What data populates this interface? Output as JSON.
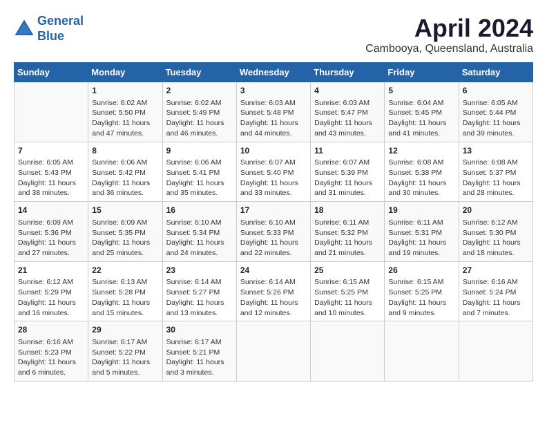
{
  "logo": {
    "line1": "General",
    "line2": "Blue"
  },
  "title": "April 2024",
  "subtitle": "Cambooya, Queensland, Australia",
  "headers": [
    "Sunday",
    "Monday",
    "Tuesday",
    "Wednesday",
    "Thursday",
    "Friday",
    "Saturday"
  ],
  "weeks": [
    [
      {
        "day": "",
        "info": ""
      },
      {
        "day": "1",
        "info": "Sunrise: 6:02 AM\nSunset: 5:50 PM\nDaylight: 11 hours\nand 47 minutes."
      },
      {
        "day": "2",
        "info": "Sunrise: 6:02 AM\nSunset: 5:49 PM\nDaylight: 11 hours\nand 46 minutes."
      },
      {
        "day": "3",
        "info": "Sunrise: 6:03 AM\nSunset: 5:48 PM\nDaylight: 11 hours\nand 44 minutes."
      },
      {
        "day": "4",
        "info": "Sunrise: 6:03 AM\nSunset: 5:47 PM\nDaylight: 11 hours\nand 43 minutes."
      },
      {
        "day": "5",
        "info": "Sunrise: 6:04 AM\nSunset: 5:45 PM\nDaylight: 11 hours\nand 41 minutes."
      },
      {
        "day": "6",
        "info": "Sunrise: 6:05 AM\nSunset: 5:44 PM\nDaylight: 11 hours\nand 39 minutes."
      }
    ],
    [
      {
        "day": "7",
        "info": "Sunrise: 6:05 AM\nSunset: 5:43 PM\nDaylight: 11 hours\nand 38 minutes."
      },
      {
        "day": "8",
        "info": "Sunrise: 6:06 AM\nSunset: 5:42 PM\nDaylight: 11 hours\nand 36 minutes."
      },
      {
        "day": "9",
        "info": "Sunrise: 6:06 AM\nSunset: 5:41 PM\nDaylight: 11 hours\nand 35 minutes."
      },
      {
        "day": "10",
        "info": "Sunrise: 6:07 AM\nSunset: 5:40 PM\nDaylight: 11 hours\nand 33 minutes."
      },
      {
        "day": "11",
        "info": "Sunrise: 6:07 AM\nSunset: 5:39 PM\nDaylight: 11 hours\nand 31 minutes."
      },
      {
        "day": "12",
        "info": "Sunrise: 6:08 AM\nSunset: 5:38 PM\nDaylight: 11 hours\nand 30 minutes."
      },
      {
        "day": "13",
        "info": "Sunrise: 6:08 AM\nSunset: 5:37 PM\nDaylight: 11 hours\nand 28 minutes."
      }
    ],
    [
      {
        "day": "14",
        "info": "Sunrise: 6:09 AM\nSunset: 5:36 PM\nDaylight: 11 hours\nand 27 minutes."
      },
      {
        "day": "15",
        "info": "Sunrise: 6:09 AM\nSunset: 5:35 PM\nDaylight: 11 hours\nand 25 minutes."
      },
      {
        "day": "16",
        "info": "Sunrise: 6:10 AM\nSunset: 5:34 PM\nDaylight: 11 hours\nand 24 minutes."
      },
      {
        "day": "17",
        "info": "Sunrise: 6:10 AM\nSunset: 5:33 PM\nDaylight: 11 hours\nand 22 minutes."
      },
      {
        "day": "18",
        "info": "Sunrise: 6:11 AM\nSunset: 5:32 PM\nDaylight: 11 hours\nand 21 minutes."
      },
      {
        "day": "19",
        "info": "Sunrise: 6:11 AM\nSunset: 5:31 PM\nDaylight: 11 hours\nand 19 minutes."
      },
      {
        "day": "20",
        "info": "Sunrise: 6:12 AM\nSunset: 5:30 PM\nDaylight: 11 hours\nand 18 minutes."
      }
    ],
    [
      {
        "day": "21",
        "info": "Sunrise: 6:12 AM\nSunset: 5:29 PM\nDaylight: 11 hours\nand 16 minutes."
      },
      {
        "day": "22",
        "info": "Sunrise: 6:13 AM\nSunset: 5:28 PM\nDaylight: 11 hours\nand 15 minutes."
      },
      {
        "day": "23",
        "info": "Sunrise: 6:14 AM\nSunset: 5:27 PM\nDaylight: 11 hours\nand 13 minutes."
      },
      {
        "day": "24",
        "info": "Sunrise: 6:14 AM\nSunset: 5:26 PM\nDaylight: 11 hours\nand 12 minutes."
      },
      {
        "day": "25",
        "info": "Sunrise: 6:15 AM\nSunset: 5:25 PM\nDaylight: 11 hours\nand 10 minutes."
      },
      {
        "day": "26",
        "info": "Sunrise: 6:15 AM\nSunset: 5:25 PM\nDaylight: 11 hours\nand 9 minutes."
      },
      {
        "day": "27",
        "info": "Sunrise: 6:16 AM\nSunset: 5:24 PM\nDaylight: 11 hours\nand 7 minutes."
      }
    ],
    [
      {
        "day": "28",
        "info": "Sunrise: 6:16 AM\nSunset: 5:23 PM\nDaylight: 11 hours\nand 6 minutes."
      },
      {
        "day": "29",
        "info": "Sunrise: 6:17 AM\nSunset: 5:22 PM\nDaylight: 11 hours\nand 5 minutes."
      },
      {
        "day": "30",
        "info": "Sunrise: 6:17 AM\nSunset: 5:21 PM\nDaylight: 11 hours\nand 3 minutes."
      },
      {
        "day": "",
        "info": ""
      },
      {
        "day": "",
        "info": ""
      },
      {
        "day": "",
        "info": ""
      },
      {
        "day": "",
        "info": ""
      }
    ]
  ]
}
